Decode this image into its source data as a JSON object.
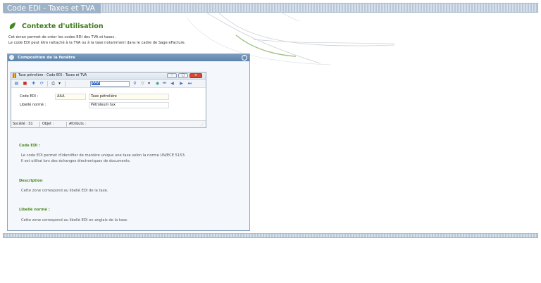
{
  "header": {
    "title": "Code EDI - Taxes et TVA"
  },
  "section": {
    "title": "Contexte d'utilisation",
    "intro_lines": [
      "Cet écran permet de créer les codes EDI des TVA et taxes .",
      "Le code EDI peut être rattaché à la TVA ou à la taxe notamment dans le cadre de Sage eFacture."
    ]
  },
  "panel": {
    "title": "Composition de la fenêtre",
    "collapse_icon": "chevron-up-icon",
    "window": {
      "title": "Taxe pétrolière - Code EDI - Taxes et TVA",
      "search_value": "AAA",
      "fields": [
        {
          "label": "Code EDI :",
          "value": "AAA",
          "extra": "Taxe pétrolière"
        },
        {
          "label": "Libellé normé :",
          "value": "Pétroleum tax"
        }
      ],
      "status": {
        "societe": "Société : S1",
        "objet": "Objet :",
        "attributs": "Attributs :"
      }
    },
    "descriptions": [
      {
        "title": "Code EDI :",
        "lines": [
          "Le code EDI permet d'identifier de manière unique une taxe selon la norme UN/ECE 5153.",
          "Il est utilisé lors des échanges électroniques de documents."
        ]
      },
      {
        "title": "Description",
        "lines": [
          "Cette zone correspond au libellé EDI de la taxe."
        ]
      },
      {
        "title": "Libellé normé :",
        "lines": [
          "Cette zone correspond au libellé EDI en anglais de la taxe."
        ]
      }
    ]
  },
  "colors": {
    "accent_green": "#3d7a1c",
    "header_blue": "#5e83ab",
    "bar_blue": "#9fb3c8"
  }
}
